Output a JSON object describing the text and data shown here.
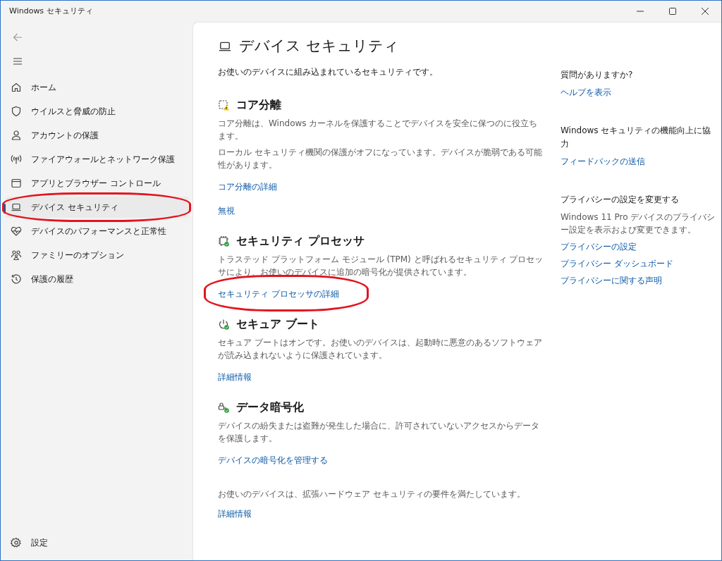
{
  "window": {
    "title": "Windows セキュリティ"
  },
  "sidebar": {
    "items": [
      {
        "label": "ホーム",
        "selected": false,
        "highlighted": false
      },
      {
        "label": "ウイルスと脅威の防止",
        "selected": false,
        "highlighted": false
      },
      {
        "label": "アカウントの保護",
        "selected": false,
        "highlighted": false
      },
      {
        "label": "ファイアウォールとネットワーク保護",
        "selected": false,
        "highlighted": false
      },
      {
        "label": "アプリとブラウザー コントロール",
        "selected": false,
        "highlighted": false
      },
      {
        "label": "デバイス セキュリティ",
        "selected": true,
        "highlighted": true
      },
      {
        "label": "デバイスのパフォーマンスと正常性",
        "selected": false,
        "highlighted": false
      },
      {
        "label": "ファミリーのオプション",
        "selected": false,
        "highlighted": false
      },
      {
        "label": "保護の履歴",
        "selected": false,
        "highlighted": false
      }
    ],
    "settings": "設定"
  },
  "page": {
    "title": "デバイス セキュリティ",
    "subtitle": "お使いのデバイスに組み込まれているセキュリティです。",
    "sections": [
      {
        "kind": "warning",
        "title": "コア分離",
        "paragraphs": [
          "コア分離は、Windows カーネルを保護することでデバイスを安全に保つのに役立ちます。",
          "ローカル セキュリティ機関の保護がオフになっています。デバイスが脆弱である可能性があります。"
        ],
        "links": [
          {
            "label": "コア分離の詳細",
            "highlighted": false
          },
          {
            "label": "無視",
            "highlighted": false
          }
        ]
      },
      {
        "kind": "ok",
        "title": "セキュリティ プロセッサ",
        "paragraphs": [
          "トラステッド プラットフォーム モジュール (TPM) と呼ばれるセキュリティ プロセッサにより、お使いのデバイスに追加の暗号化が提供されています。"
        ],
        "links": [
          {
            "label": "セキュリティ プロセッサの詳細",
            "highlighted": true
          }
        ]
      },
      {
        "kind": "ok",
        "title": "セキュア ブート",
        "paragraphs": [
          "セキュア ブートはオンです。お使いのデバイスは、起動時に悪意のあるソフトウェアが読み込まれないように保護されています。"
        ],
        "links": [
          {
            "label": "詳細情報",
            "highlighted": false
          }
        ]
      },
      {
        "kind": "ok",
        "title": "データ暗号化",
        "paragraphs": [
          "デバイスの紛失または盗難が発生した場合に、許可されていないアクセスからデータを保護します。"
        ],
        "links": [
          {
            "label": "デバイスの暗号化を管理する",
            "highlighted": false
          }
        ]
      }
    ],
    "footer": {
      "text": "お使いのデバイスは、拡張ハードウェア セキュリティの要件を満たしています。",
      "link": "詳細情報"
    }
  },
  "aside": [
    {
      "heading": "質問がありますか?",
      "links": [
        "ヘルプを表示"
      ]
    },
    {
      "heading": "Windows セキュリティの機能向上に協力",
      "links": [
        "フィードバックの送信"
      ]
    },
    {
      "heading": "プライバシーの設定を変更する",
      "text": "Windows 11 Pro デバイスのプライバシー設定を表示および変更できます。",
      "links": [
        "プライバシーの設定",
        "プライバシー ダッシュボード",
        "プライバシーに関する声明"
      ]
    }
  ]
}
